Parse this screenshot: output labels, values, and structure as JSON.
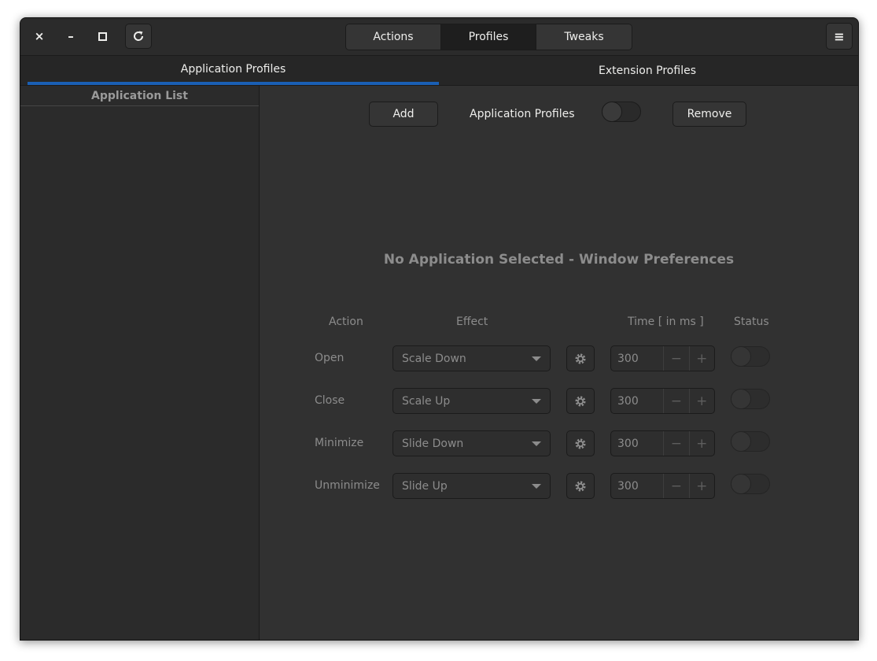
{
  "header": {
    "switcher": [
      "Actions",
      "Profiles",
      "Tweaks"
    ],
    "active_switch": "Profiles",
    "close_icon": "×",
    "minimize_icon": "–",
    "menu_icon": "≡"
  },
  "tabs": {
    "application_profiles": "Application Profiles",
    "extension_profiles": "Extension Profiles"
  },
  "sidebar": {
    "title": "Application List"
  },
  "toolbar": {
    "add_label": "Add",
    "profiles_label": "Application Profiles",
    "remove_label": "Remove",
    "profiles_enabled": false
  },
  "main": {
    "heading": "No Application Selected - Window Preferences",
    "columns": {
      "action": "Action",
      "effect": "Effect",
      "time": "Time [ in ms ]",
      "status": "Status"
    },
    "rows": [
      {
        "action": "Open",
        "effect": "Scale Down",
        "time": "300",
        "minus": "−",
        "plus": "+",
        "enabled": false
      },
      {
        "action": "Close",
        "effect": "Scale Up",
        "time": "300",
        "minus": "−",
        "plus": "+",
        "enabled": false
      },
      {
        "action": "Minimize",
        "effect": "Slide Down",
        "time": "300",
        "minus": "−",
        "plus": "+",
        "enabled": false
      },
      {
        "action": "Unminimize",
        "effect": "Slide Up",
        "time": "300",
        "minus": "−",
        "plus": "+",
        "enabled": false
      }
    ]
  },
  "colors": {
    "accent": "#1a5fb4",
    "window_bg": "#2d2d2d"
  }
}
